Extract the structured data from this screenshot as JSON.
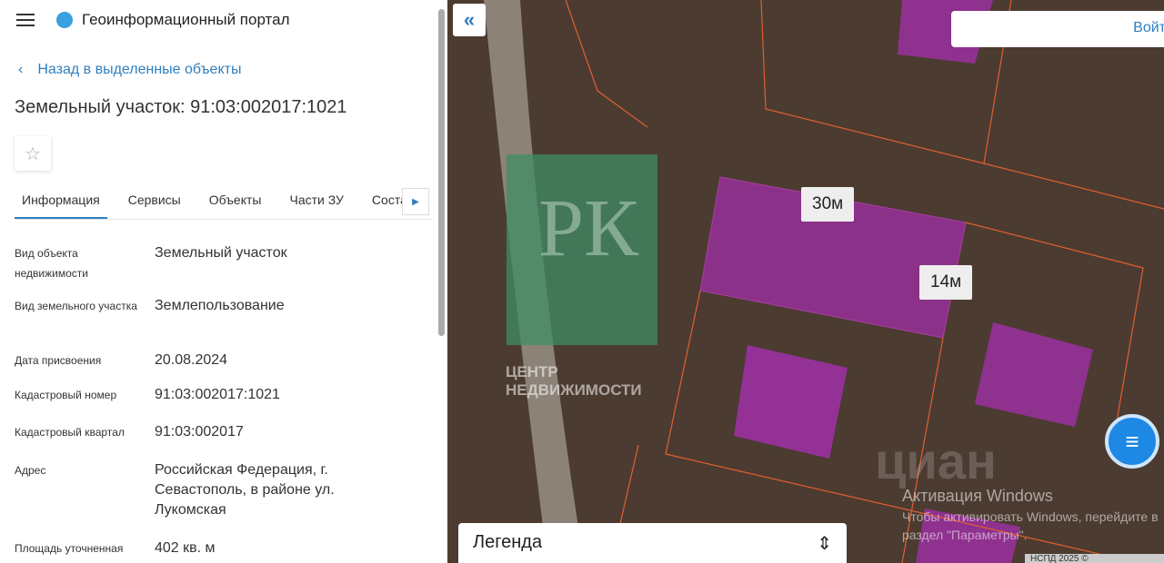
{
  "header": {
    "app_title": "Геоинформационный портал"
  },
  "back_link": "Назад в выделенные объекты",
  "title": "Земельный участок: 91:03:002017:1021",
  "tabs": [
    "Информация",
    "Сервисы",
    "Объекты",
    "Части ЗУ",
    "Соста"
  ],
  "fields": [
    {
      "label": "Вид объекта недвижимости",
      "value": "Земельный участок"
    },
    {
      "label": "Вид земельного участка",
      "value": "Землепользование"
    },
    {
      "label": "Дата присвоения",
      "value": "20.08.2024"
    },
    {
      "label": "Кадастровый номер",
      "value": "91:03:002017:1021"
    },
    {
      "label": "Кадастровый квартал",
      "value": "91:03:002017"
    },
    {
      "label": "Адрес",
      "value": "Российская Федерация, г. Севастополь, в районе ул. Лукомская"
    },
    {
      "label": "Площадь уточненная",
      "value": "402 кв. м"
    }
  ],
  "map": {
    "login": "Войт",
    "dim1": "30м",
    "dim2": "14м",
    "legend": "Легенда",
    "watermark_logo": "РК",
    "watermark_text": "ЦЕНТР НЕДВИЖИМОСТИ",
    "cian": "циан",
    "win_title": "Активация Windows",
    "win_text": "Чтобы активировать Windows, перейдите в раздел \"Параметры\".",
    "copyright": "НСПД 2025 ©"
  }
}
